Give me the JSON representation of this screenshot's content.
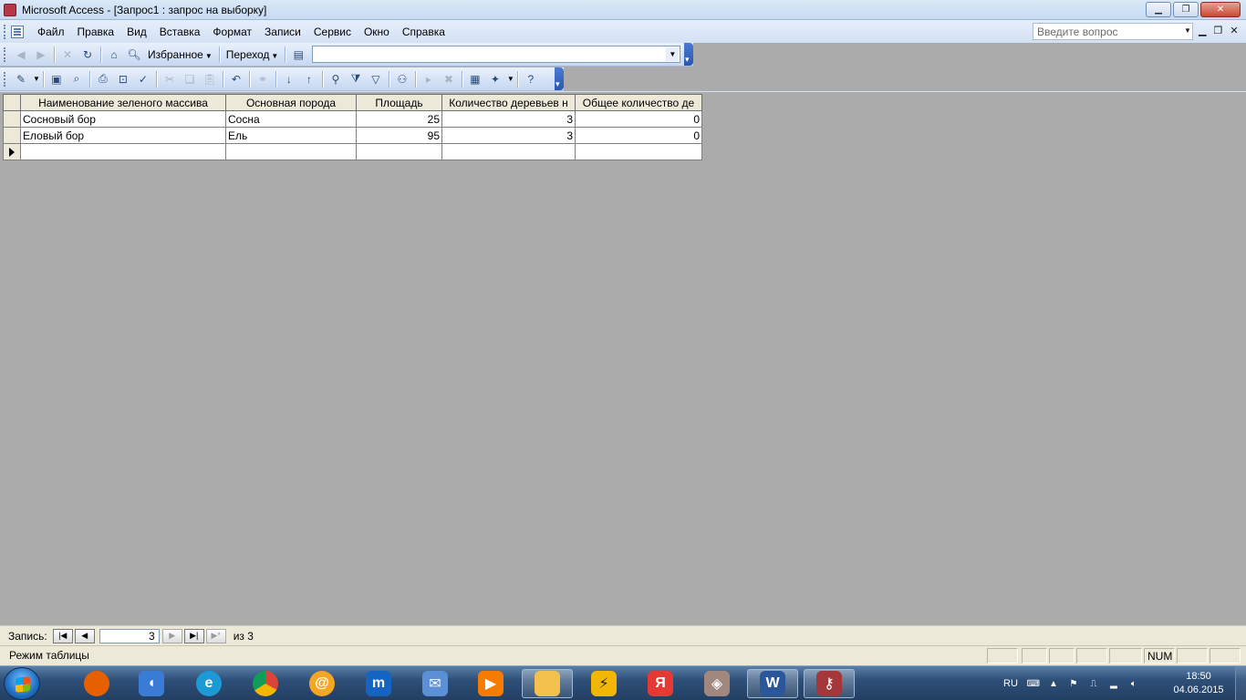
{
  "window": {
    "title": "Microsoft Access - [Запрос1 : запрос на выборку]",
    "minimize_label": "▁",
    "restore_label": "❐",
    "close_label": "✕"
  },
  "menu": {
    "items": [
      {
        "label": "Файл"
      },
      {
        "label": "Правка"
      },
      {
        "label": "Вид"
      },
      {
        "label": "Вставка"
      },
      {
        "label": "Формат"
      },
      {
        "label": "Записи"
      },
      {
        "label": "Сервис"
      },
      {
        "label": "Окно"
      },
      {
        "label": "Справка"
      }
    ],
    "help_placeholder": "Введите вопрос"
  },
  "toolbar_web": {
    "favorites_label": "Избранное",
    "goto_label": "Переход",
    "address_value": ""
  },
  "datasheet": {
    "columns": [
      "Наименование зеленого массива",
      "Основная порода",
      "Площадь",
      "Количество деревьев н",
      "Общее количество де"
    ],
    "rows": [
      {
        "name": "Сосновый бор",
        "species": "Сосна",
        "area": "25",
        "trees_count": "3",
        "total_count": "0"
      },
      {
        "name": "Еловый бор",
        "species": "Ель",
        "area": "95",
        "trees_count": "3",
        "total_count": "0"
      }
    ]
  },
  "record_nav": {
    "label": "Запись:",
    "current": "3",
    "of_text": "из  3"
  },
  "status": {
    "mode": "Режим таблицы",
    "num": "NUM"
  },
  "taskbar": {
    "language": "RU",
    "time": "18:50",
    "date": "04.06.2015",
    "apps": [
      {
        "name": "firefox-icon",
        "color": "#e66000"
      },
      {
        "name": "volume-app-icon",
        "color": "#3a7bd5"
      },
      {
        "name": "internet-explorer-icon",
        "color": "#1c9ad6"
      },
      {
        "name": "chrome-icon",
        "color": "#db4437"
      },
      {
        "name": "mail-ru-agent-icon",
        "color": "#f5a623"
      },
      {
        "name": "maxthon-icon",
        "color": "#1565c0"
      },
      {
        "name": "mail-envelope-icon",
        "color": "#5b8fd6"
      },
      {
        "name": "media-player-icon",
        "color": "#f57c00"
      },
      {
        "name": "file-explorer-icon",
        "color": "#f2c14e"
      },
      {
        "name": "winamp-icon",
        "color": "#f2b705"
      },
      {
        "name": "yandex-browser-icon",
        "color": "#e53935"
      },
      {
        "name": "mahjong-game-icon",
        "color": "#a1887f"
      },
      {
        "name": "word-icon",
        "color": "#2b579a"
      },
      {
        "name": "access-icon",
        "color": "#a4373a"
      }
    ]
  }
}
